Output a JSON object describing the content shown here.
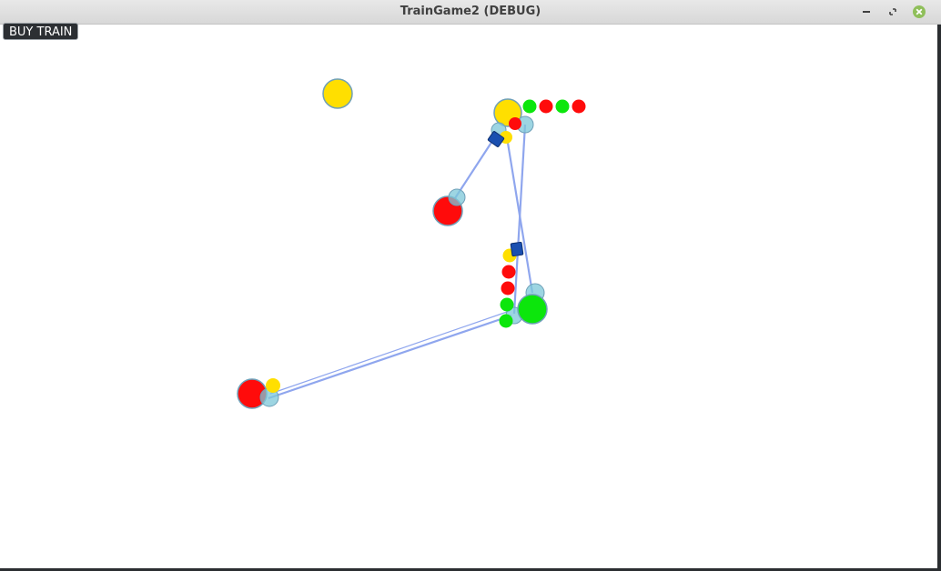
{
  "window": {
    "title": "TrainGame2 (DEBUG)"
  },
  "ui": {
    "buy_train_label": "BUY TRAIN"
  },
  "colors": {
    "track": "#8fa6ee",
    "station_outline": "#6fa0b8",
    "platform": "#7cc7d8",
    "train": "#1a4fb0",
    "yellow": "#ffdf00",
    "red": "#ff0b0b",
    "green": "#0ce60c"
  },
  "scene": {
    "stations": [
      {
        "id": "station-yellow-top-left",
        "color": "yellow"
      },
      {
        "id": "station-yellow-top",
        "color": "yellow"
      },
      {
        "id": "station-red-middle",
        "color": "red"
      },
      {
        "id": "station-green-center",
        "color": "green"
      },
      {
        "id": "station-red-bottom-left",
        "color": "red"
      }
    ],
    "waiting_cargo_row_top": [
      "green",
      "red",
      "green",
      "red"
    ],
    "waiting_cargo_column_center": [
      "yellow",
      "red",
      "red",
      "green",
      "green"
    ],
    "trains": [
      {
        "id": "train-upper",
        "color": "train"
      },
      {
        "id": "train-lower",
        "color": "train"
      }
    ]
  }
}
